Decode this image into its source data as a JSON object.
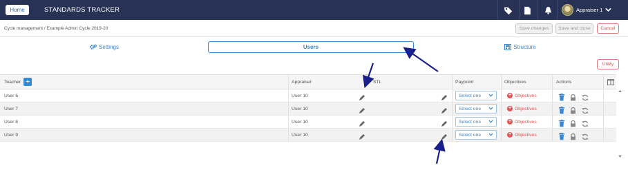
{
  "topbar": {
    "home_label": "Home",
    "title": "STANDARDS TRACKER",
    "user_name": "Appraiser 1",
    "icons": [
      "tag-icon",
      "document-icon",
      "bell-icon"
    ]
  },
  "toolbar": {
    "breadcrumb": "Cycle management / Example Admin Cycle 2019-20",
    "save_changes": "Save changes",
    "save_and_close": "Save and close",
    "cancel": "Cancel"
  },
  "tabs": [
    {
      "label": "Settings",
      "icon": "gears-icon",
      "active": false
    },
    {
      "label": "Users",
      "icon": "",
      "active": true
    },
    {
      "label": "Structure",
      "icon": "sitemap-icon",
      "active": false
    }
  ],
  "utility_label": "Utility",
  "table": {
    "headers": {
      "teacher": "Teacher",
      "appraiser": "Appraiser",
      "stl": "STL",
      "paypoint": "Paypoint",
      "objectives": "Objectives",
      "actions": "Actions"
    },
    "rows": [
      {
        "teacher": "User 6",
        "appraiser": "User 10",
        "paypoint": "Select one",
        "objectives": "Objectives"
      },
      {
        "teacher": "User 7",
        "appraiser": "User 10",
        "paypoint": "Select one",
        "objectives": "Objectives"
      },
      {
        "teacher": "User 8",
        "appraiser": "User 10",
        "paypoint": "Select one",
        "objectives": "Objectives"
      },
      {
        "teacher": "User 9",
        "appraiser": "User 10",
        "paypoint": "Select one",
        "objectives": "Objectives"
      }
    ]
  },
  "colors": {
    "topbar": "#283255",
    "accent": "#3a86d1",
    "danger": "#e25555",
    "annotation_arrow": "#1a1f8c"
  }
}
